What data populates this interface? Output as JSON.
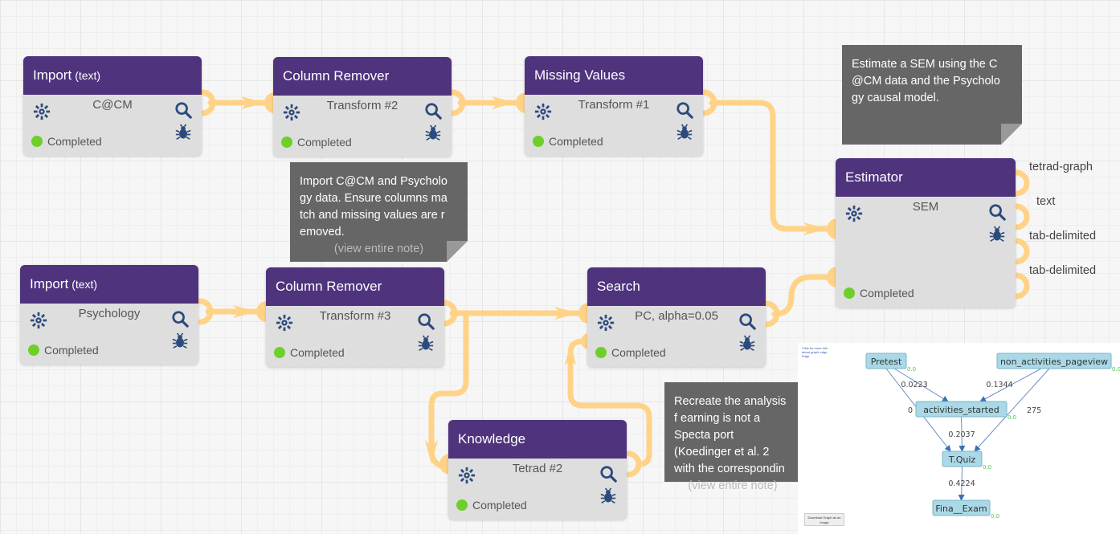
{
  "nodes": [
    {
      "id": "import1",
      "type": "Import",
      "type_sub": "(text)",
      "label": "C@CM",
      "status": "Completed"
    },
    {
      "id": "colrem2",
      "type": "Column Remover",
      "type_sub": "",
      "label": "Transform #2",
      "status": "Completed"
    },
    {
      "id": "missing1",
      "type": "Missing Values",
      "type_sub": "",
      "label": "Transform #1",
      "status": "Completed"
    },
    {
      "id": "estimator",
      "type": "Estimator",
      "type_sub": "",
      "label": "SEM",
      "status": "Completed"
    },
    {
      "id": "import2",
      "type": "Import",
      "type_sub": "(text)",
      "label": "Psychology",
      "status": "Completed"
    },
    {
      "id": "colrem3",
      "type": "Column Remover",
      "type_sub": "",
      "label": "Transform #3",
      "status": "Completed"
    },
    {
      "id": "search",
      "type": "Search",
      "type_sub": "",
      "label": "PC, alpha=0.05",
      "status": "Completed"
    },
    {
      "id": "knowledge",
      "type": "Knowledge",
      "type_sub": "",
      "label": "Tetrad #2",
      "status": "Completed"
    }
  ],
  "notes": [
    {
      "text": "Import C@CM and Psycholo gy data. Ensure columns ma tch and missing values are r emoved.",
      "more": "(view entire note)"
    },
    {
      "text": "Estimate a SEM using the C @CM data and the Psycholo gy causal model.",
      "more": ""
    },
    {
      "text": "Recreate the analysis f earning is not a Specta port (Koedinger et al. 2 with the correspondin",
      "more": "(view entire note)"
    }
  ],
  "estimator_outputs": [
    "tetrad-graph",
    "text",
    "tab-delimited",
    "tab-delimited"
  ],
  "graph_panel": {
    "hint_text": "Click for more info about graph edge. Edge",
    "download_label": "Download Graph as an Image",
    "nodes": [
      {
        "name": "Pretest",
        "value": "0.0"
      },
      {
        "name": "non_activities_pageview",
        "value": "0.0"
      },
      {
        "name": "activities_started",
        "value": "0.0"
      },
      {
        "name": "T.Quiz",
        "value": "0.0"
      },
      {
        "name": "Fina__Exam",
        "value": "0.0"
      }
    ],
    "edges": [
      {
        "from": "Pretest",
        "to": "activities_started",
        "weight": "0.0223"
      },
      {
        "from": "non_activities_pageview",
        "to": "activities_started",
        "weight": "0.1344"
      },
      {
        "from": "Pretest",
        "to": "T.Quiz",
        "weight": "0"
      },
      {
        "from": "non_activities_pageview",
        "to": "T.Quiz",
        "weight": "275"
      },
      {
        "from": "activities_started",
        "to": "T.Quiz",
        "weight": "0.2037"
      },
      {
        "from": "T.Quiz",
        "to": "Fina__Exam",
        "weight": "0.4224"
      }
    ]
  },
  "colors": {
    "header": "#4f337d",
    "wire": "#ffd387",
    "status_ok": "#6fcf2a",
    "icon": "#2c4a7c",
    "note": "#666666"
  }
}
